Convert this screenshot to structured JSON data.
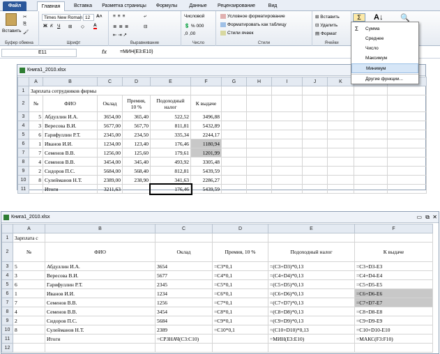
{
  "tabs": [
    "Файл",
    "Главная",
    "Вставка",
    "Разметка страницы",
    "Формулы",
    "Данные",
    "Рецензирование",
    "Вид"
  ],
  "ribbon": {
    "paste": "Вставить",
    "clipboard": "Буфер обмена",
    "font_name": "Times New Roman",
    "font_size": "12",
    "font_group": "Шрифт",
    "align_group": "Выравнивание",
    "number_format": "Числовой",
    "number_group": "Число",
    "cond_format": "Условное форматирование",
    "format_table": "Форматировать как таблицу",
    "cell_styles": "Стили ячеек",
    "styles_group": "Стили",
    "insert": "Вставить",
    "delete": "Удалить",
    "format": "Формат",
    "cells_group": "Ячейки",
    "sigma": "Σ"
  },
  "formula_bar": {
    "cell": "E11",
    "fx": "fx",
    "formula": "=МИН(E3:E10)"
  },
  "dropdown": [
    "Сумма",
    "Среднее",
    "Число",
    "Максимум",
    "Минимум",
    "Другие функции..."
  ],
  "wb1": {
    "title": "Книга1_2010.xlsx",
    "cols": [
      "A",
      "B",
      "C",
      "D",
      "E",
      "F",
      "G",
      "H",
      "I",
      "J",
      "K",
      "L",
      "M",
      "N"
    ],
    "r1": "Зарплата сотрудников фирмы",
    "head": {
      "no": "№",
      "fio": "ФИО",
      "salary": "Оклад",
      "bonus1": "Премия,",
      "bonus2": "10 %",
      "tax1": "Подоходный",
      "tax2": "налог",
      "pay": "К выдаче"
    },
    "rows": [
      [
        "3",
        "5",
        "Абдуллин И.А.",
        "3654,00",
        "365,40",
        "522,52",
        "3496,88"
      ],
      [
        "4",
        "3",
        "Вересова В.И.",
        "5677,00",
        "567,70",
        "811,81",
        "5432,89"
      ],
      [
        "5",
        "6",
        "Гарифуллин Р.Т.",
        "2345,00",
        "234,50",
        "335,34",
        "2244,17"
      ],
      [
        "6",
        "1",
        "Иванов И.И.",
        "1234,00",
        "123,40",
        "176,46",
        "1180,94"
      ],
      [
        "7",
        "7",
        "Семенов В.В.",
        "1256,00",
        "125,60",
        "179,61",
        "1201,99"
      ],
      [
        "8",
        "4",
        "Семенов В.В.",
        "3454,00",
        "345,40",
        "493,92",
        "3305,48"
      ],
      [
        "9",
        "2",
        "Сидоров П.С.",
        "5684,00",
        "568,40",
        "812,81",
        "5439,59"
      ],
      [
        "10",
        "8",
        "Сулейманов Н.Т.",
        "2389,00",
        "238,90",
        "341,63",
        "2286,27"
      ]
    ],
    "total": [
      "11",
      "",
      "Итоги",
      "3211,63",
      "",
      "176,46",
      "5439,59"
    ]
  },
  "wb2": {
    "title": "Книга1_2010.xlsx",
    "cols": [
      "A",
      "B",
      "C",
      "D",
      "E",
      "F"
    ],
    "r1": "Зарплата с",
    "head": {
      "no": "№",
      "fio": "ФИО",
      "salary": "Оклад",
      "bonus": "Премия, 10 %",
      "tax": "Подоходный налог",
      "pay": "К выдаче"
    },
    "rows": [
      [
        "3",
        "5",
        "Абдуллин И.А.",
        "3654",
        "=C3*0,1",
        "=(C3+D3)*0,13",
        "=C3+D3-E3"
      ],
      [
        "4",
        "3",
        "Вересова В.И.",
        "5677",
        "=C4*0,1",
        "=(C4+D4)*0,13",
        "=C4+D4-E4"
      ],
      [
        "5",
        "6",
        "Гарифуллин Р.Т.",
        "2345",
        "=C5*0,1",
        "=(C5+D5)*0,13",
        "=C5+D5-E5"
      ],
      [
        "6",
        "1",
        "Иванов И.И.",
        "1234",
        "=C6*0,1",
        "=(C6+D6)*0,13",
        "=C6+D6-E6"
      ],
      [
        "7",
        "7",
        "Семенов В.В.",
        "1256",
        "=C7*0,1",
        "=(C7+D7)*0,13",
        "=C7+D7-E7"
      ],
      [
        "8",
        "4",
        "Семенов В.В.",
        "3454",
        "=C8*0,1",
        "=(C8+D8)*0,13",
        "=C8+D8-E8"
      ],
      [
        "9",
        "2",
        "Сидоров П.С.",
        "5684",
        "=C9*0,1",
        "=(C9+D9)*0,13",
        "=C9+D9-E9"
      ],
      [
        "10",
        "8",
        "Сулейманов Н.Т.",
        "2389",
        "=C10*0,1",
        "=(C10+D10)*0,13",
        "=C10+D10-E10"
      ]
    ],
    "total": [
      "11",
      "",
      "Итоги",
      "=СРЗНАЧ(C3:C10)",
      "",
      "=МИН(E3:E10)",
      "=МАКС(F3:F10)"
    ],
    "r12": "12"
  }
}
